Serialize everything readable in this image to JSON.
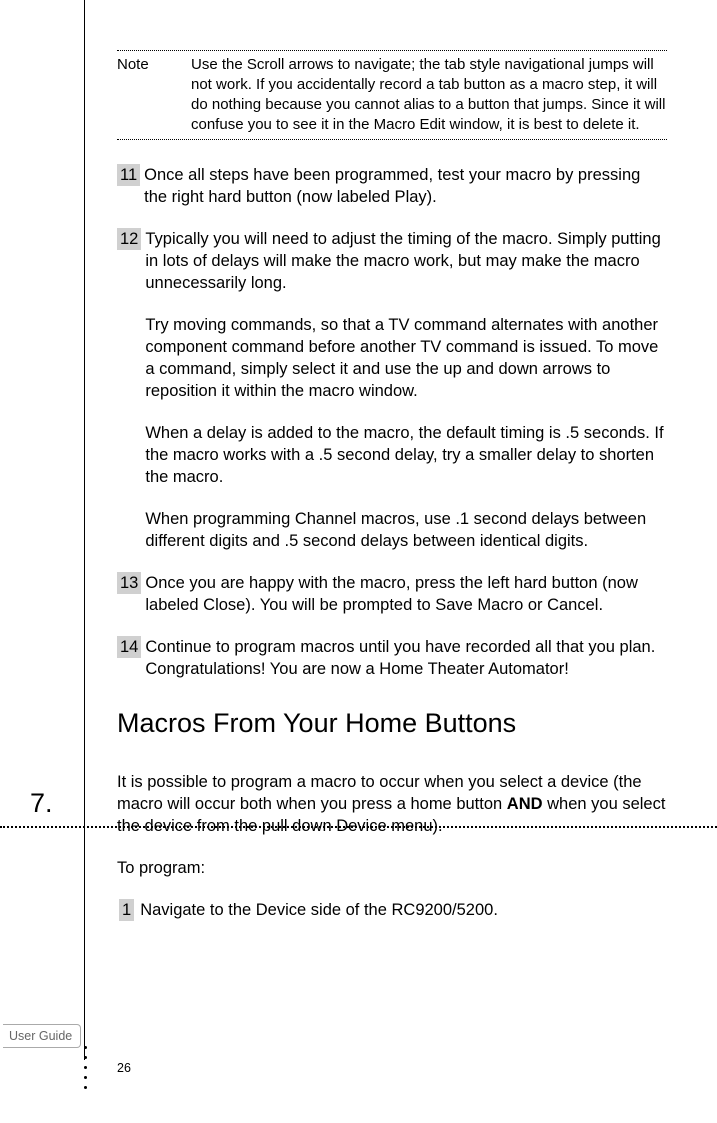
{
  "note": {
    "label": "Note",
    "text": "Use the Scroll arrows to navigate; the tab style navigational jumps will not work. If you accidentally record a tab button as a macro step, it will do nothing because you cannot alias to a button that jumps. Since it will confuse you to see it in the Macro Edit window,  it is best to delete it."
  },
  "steps": {
    "s11": {
      "num": "11",
      "p1": "Once all steps have been programmed, test your macro by pressing the right hard button (now labeled Play)."
    },
    "s12": {
      "num": "12",
      "p1": "Typically you will need to adjust the timing of the macro. Simply putting in lots of delays will make the macro work, but may make the macro unnecessarily long.",
      "p2": "Try moving commands, so that a TV command alternates with another component command before another TV command is issued. To move a command, simply select it and use the up and down arrows to reposition it within the macro window.",
      "p3": "When a delay is added to the macro, the default timing is .5 seconds. If the macro works with a .5 second delay, try a smaller delay to shorten the macro.",
      "p4": "When programming Channel macros, use .1 second delays between different digits and .5 second delays between identical digits."
    },
    "s13": {
      "num": "13",
      "p1": "Once you are happy with the macro, press the left hard button (now labeled Close). You will be prompted to Save Macro or Cancel."
    },
    "s14": {
      "num": "14",
      "p1": "Continue to program macros until you have recorded all that you plan. Congratulations! You are now a Home Theater Automator!"
    }
  },
  "section": {
    "number": "7.",
    "heading": "Macros From Your Home Buttons",
    "intro_pre": "It is possible to program a macro to occur when you select a device (the macro will occur both when you press a home button ",
    "intro_bold": "AND",
    "intro_post": " when you select the device from the pull down Device menu).",
    "to_program": "To program:",
    "step1_num": "1",
    "step1_text": "Navigate to the Device side of the RC9200/5200."
  },
  "footer": {
    "label": "User Guide",
    "page": "26"
  }
}
